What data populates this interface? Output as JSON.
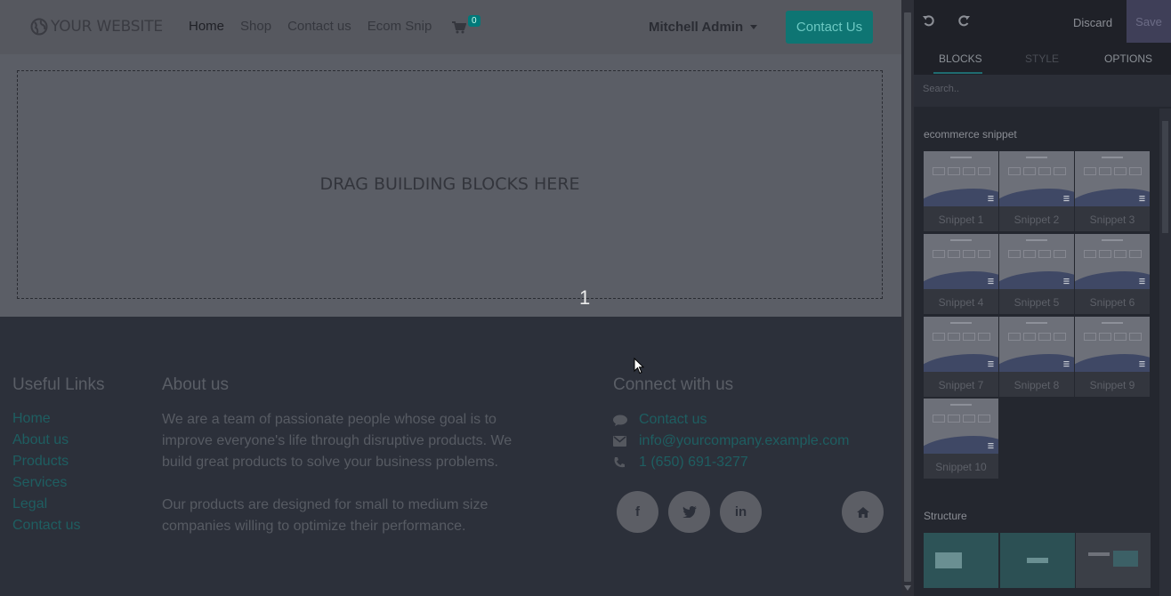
{
  "navbar": {
    "logo": "YOUR WEBSITE",
    "links": [
      "Home",
      "Shop",
      "Contact us",
      "Ecom Snip"
    ],
    "cart_count": "0",
    "user": "Mitchell Admin",
    "contact_button": "Contact Us"
  },
  "drop_zone": {
    "text": "DRAG BUILDING BLOCKS HERE",
    "number": "1"
  },
  "footer": {
    "useful_links": {
      "title": "Useful Links",
      "items": [
        "Home",
        "About us",
        "Products",
        "Services",
        "Legal",
        "Contact us"
      ]
    },
    "about": {
      "title": "About us",
      "paragraph1": "We are a team of passionate people whose goal is to improve everyone's life through disruptive products. We build great products to solve your business problems.",
      "paragraph2": "Our products are designed for small to medium size companies willing to optimize their performance."
    },
    "connect": {
      "title": "Connect with us",
      "contact": "Contact us",
      "email": "info@yourcompany.example.com",
      "phone": "1 (650) 691-3277"
    },
    "social": [
      "f",
      "t",
      "in",
      "home"
    ]
  },
  "panel": {
    "discard": "Discard",
    "save": "Save",
    "tabs": [
      "BLOCKS",
      "STYLE",
      "OPTIONS"
    ],
    "search_placeholder": "Search..",
    "section_ecommerce": "ecommerce snippet",
    "snippets": [
      "Snippet 1",
      "Snippet 2",
      "Snippet 3",
      "Snippet 4",
      "Snippet 5",
      "Snippet 6",
      "Snippet 7",
      "Snippet 8",
      "Snippet 9",
      "Snippet 10"
    ],
    "section_structure": "Structure"
  },
  "colors": {
    "overlay_nav": "#56585f",
    "primary": "#0e7573",
    "footer_bg": "#2c303a",
    "link": "#1e5e61"
  }
}
